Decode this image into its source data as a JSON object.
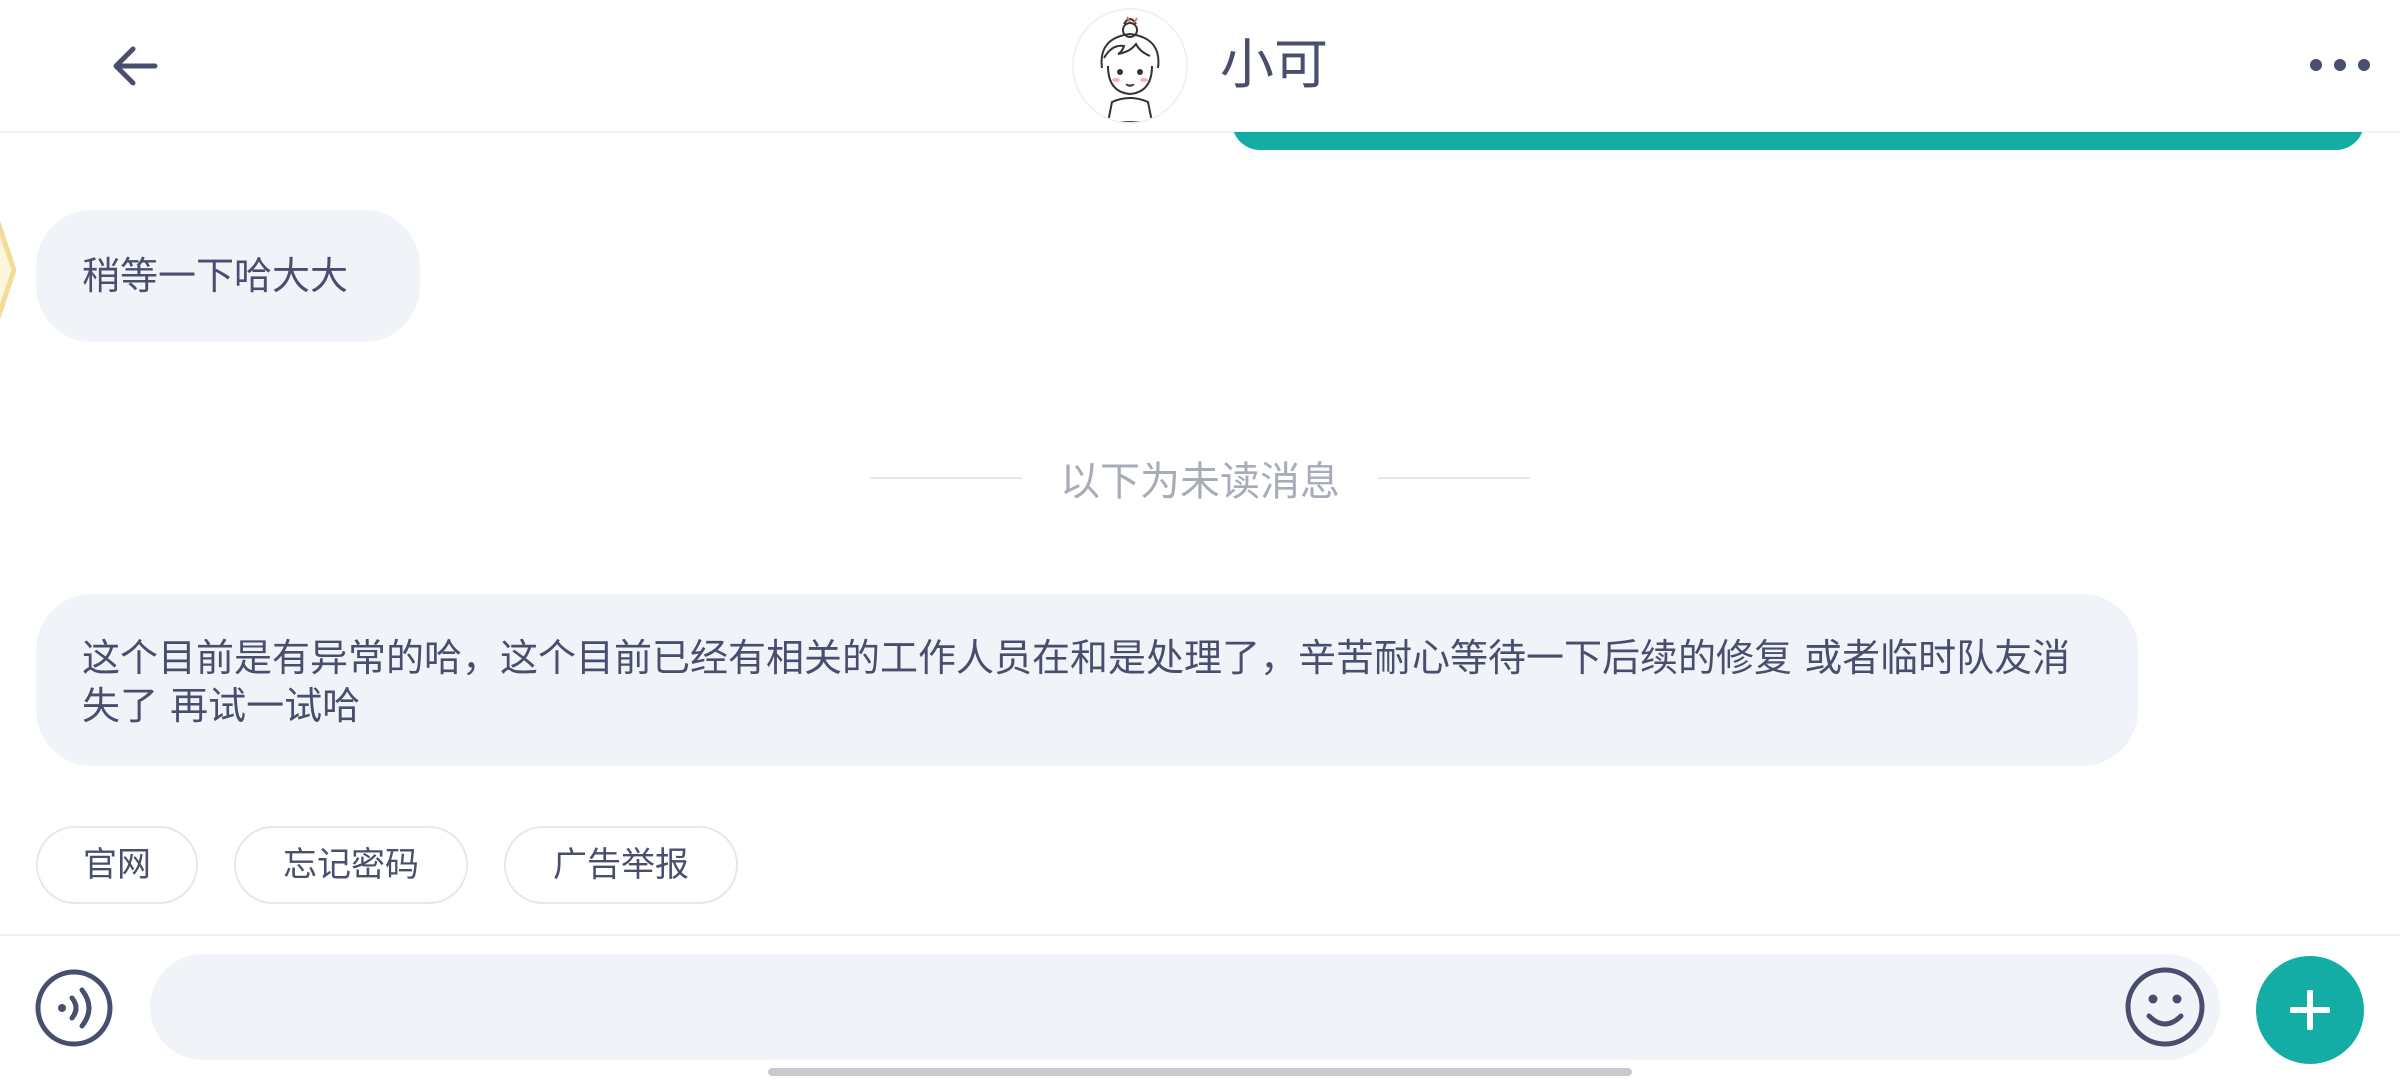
{
  "header": {
    "title": "小可",
    "icons": {
      "back": "arrow-left-icon",
      "more": "more-dots-icon",
      "avatar": "cartoon-girl-avatar"
    }
  },
  "messages": [
    {
      "from": "agent",
      "text": "稍等一下哈大大"
    },
    {
      "from": "agent",
      "text": "这个目前是有异常的哈，这个目前已经有相关的工作人员在和是处理了，辛苦耐心等待一下后续的修复 或者临时队友消失了 再试一试哈"
    }
  ],
  "divider": {
    "text": "以下为未读消息"
  },
  "quick_replies": [
    "官网",
    "忘记密码",
    "广告举报"
  ],
  "input": {
    "value": "",
    "placeholder": ""
  },
  "colors": {
    "accent": "#13ada6",
    "text": "#4a4e6e",
    "bubble": "#f0f3f7",
    "muted": "#a7acb8"
  }
}
